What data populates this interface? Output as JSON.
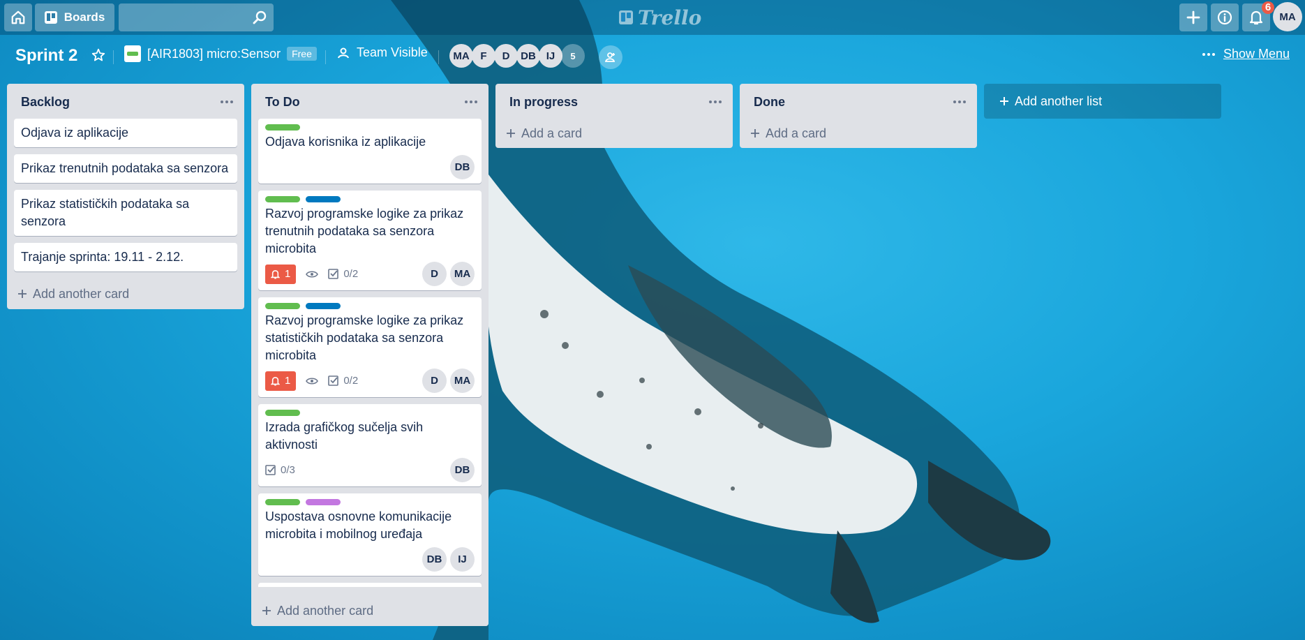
{
  "header": {
    "boards_label": "Boards",
    "search_value": "",
    "logo_text": "Trello",
    "notifications_count": "6",
    "user_initials": "MA"
  },
  "board": {
    "title": "Sprint 2",
    "team_name": "[AIR1803] micro:Sensor",
    "team_plan": "Free",
    "visibility": "Team Visible",
    "members": [
      "MA",
      "F",
      "D",
      "DB",
      "IJ"
    ],
    "more_members": "5",
    "show_menu": "Show Menu"
  },
  "lists": [
    {
      "title": "Backlog",
      "cards": [
        {
          "text": "Odjava iz aplikacije"
        },
        {
          "text": "Prikaz trenutnih podataka sa senzora"
        },
        {
          "text": "Prikaz statističkih podataka sa senzora"
        },
        {
          "text": "Trajanje sprinta: 19.11 - 2.12."
        }
      ],
      "add_card": "Add another card"
    },
    {
      "title": "To Do",
      "cards": [
        {
          "labels": [
            "green"
          ],
          "text": "Odjava korisnika iz aplikacije",
          "members": [
            "DB"
          ]
        },
        {
          "labels": [
            "green",
            "blue"
          ],
          "text": "Razvoj programske logike za prikaz trenutnih podataka sa senzora microbita",
          "notifications": "1",
          "checklist": "0/2",
          "members": [
            "D",
            "MA"
          ]
        },
        {
          "labels": [
            "green",
            "blue"
          ],
          "text": "Razvoj programske logike za prikaz statističkih podataka sa senzora microbita",
          "notifications": "1",
          "checklist": "0/2",
          "members": [
            "D",
            "MA"
          ]
        },
        {
          "labels": [
            "green"
          ],
          "text": "Izrada grafičkog sučelja svih aktivnosti",
          "checklist": "0/3",
          "members": [
            "DB"
          ]
        },
        {
          "labels": [
            "green",
            "purple"
          ],
          "text": "Uspostava osnovne komunikacije microbita i mobilnog uređaja",
          "members": [
            "DB",
            "IJ"
          ]
        }
      ],
      "add_card": "Add another card"
    },
    {
      "title": "In progress",
      "cards": [],
      "add_card": "Add a card"
    },
    {
      "title": "Done",
      "cards": [],
      "add_card": "Add a card"
    }
  ],
  "add_list": "Add another list",
  "colors": {
    "green": "#61bd4f",
    "blue": "#0079bf",
    "purple": "#c377e0",
    "red": "#eb5a46"
  }
}
